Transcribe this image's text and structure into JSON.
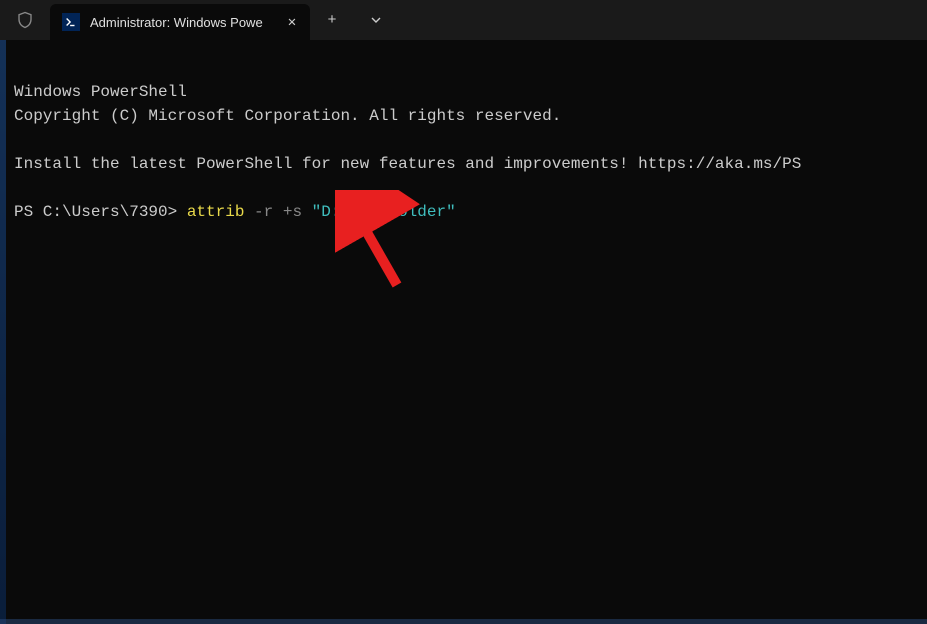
{
  "titlebar": {
    "tab": {
      "icon_text": ">_",
      "title": "Administrator: Windows Powe",
      "close": "✕"
    },
    "new_tab": "+",
    "dropdown": "⌄"
  },
  "terminal": {
    "line1": "Windows PowerShell",
    "line2": "Copyright (C) Microsoft Corporation. All rights reserved.",
    "line3": "",
    "line4": "Install the latest PowerShell for new features and improvements! https://aka.ms/PS",
    "line5": "",
    "prompt": "PS C:\\Users\\7390> ",
    "cmd": "attrib",
    "flags": " -r +s ",
    "path": "\"D:\\New folder\""
  }
}
